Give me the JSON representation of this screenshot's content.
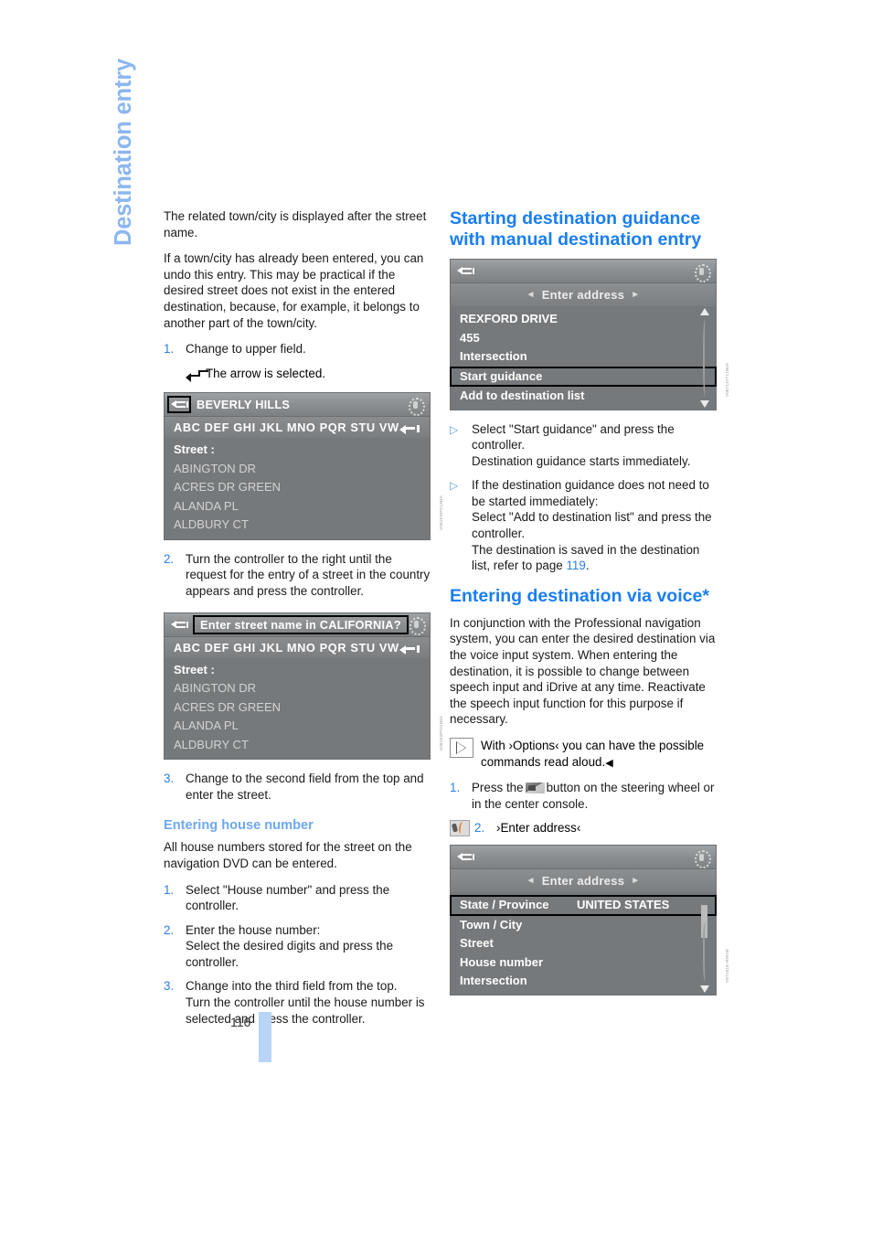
{
  "chapter": {
    "title": "Destination entry"
  },
  "page": {
    "number": "116"
  },
  "left_column": {
    "intro_1": "The related town/city is displayed after the street name.",
    "intro_2": "If a town/city has already been entered, you can undo this entry. This may be practical if the desired street does not exist in the entered destination, because, for example, it belongs to another part of the town/city.",
    "step1": {
      "num": "1.",
      "text": "Change to upper field.",
      "note": "The arrow is selected."
    },
    "step2": {
      "num": "2.",
      "text": "Turn the controller to the right until the request for the entry of a street in the country appears and press the controller."
    },
    "step3": {
      "num": "3.",
      "text": "Change to the second field from the top and enter the street."
    },
    "house_number": {
      "heading": "Entering house number",
      "intro": "All house numbers stored for the street on the navigation DVD can be entered.",
      "step1": {
        "num": "1.",
        "text": "Select \"House number\" and press the controller."
      },
      "step2": {
        "num": "2.",
        "text": "Enter the house number:",
        "sub": "Select the desired digits and press the controller."
      },
      "step3": {
        "num": "3.",
        "text": "Change into the third field from the top.",
        "sub": "Turn the controller until the house number is selected and press the controller."
      }
    }
  },
  "right_column": {
    "heading_guidance": "Starting destination guidance with manual destination entry",
    "bullet1": {
      "marker": "▷",
      "text": "Select \"Start guidance\" and press the controller.",
      "sub": "Destination guidance starts immediately."
    },
    "bullet2": {
      "marker": "▷",
      "text": "If the destination guidance does not need to be started immediately:",
      "sub1": "Select \"Add to destination list\" and press the controller.",
      "sub2_pre": "The destination is saved in the destination list, refer to page ",
      "sub2_page": "119",
      "sub2_post": "."
    },
    "heading_voice": "Entering destination via voice*",
    "voice_intro": "In conjunction with the Professional navigation system, you can enter the desired destination via the voice input system. When entering the destination, it is possible to change between speech input and iDrive at any time. Reactivate the speech input function for this purpose if necessary.",
    "options_hint": {
      "text": "With ›Options‹ you can have the possible commands read aloud.",
      "endmark": "◀"
    },
    "voice_step1": {
      "num": "1.",
      "text_pre": "Press the",
      "text_post": "button on the steering wheel or in the center console."
    },
    "voice_step2": {
      "num": "2.",
      "text": "›Enter address‹"
    }
  },
  "screenshots": {
    "beverly_hills": {
      "back_icon": "back-arrow-icon",
      "title": "BEVERLY HILLS",
      "knob_icon": "controller-knob-icon",
      "keys": "ABC DEF GHI JKL MNO PQR STU VW",
      "backspace_icon": "backspace-icon",
      "list_label": "Street :",
      "items": [
        "ABINGTON DR",
        "ACRES DR GREEN",
        "ALANDA PL",
        "ALDBURY CT"
      ],
      "code": "V081EWFD1N4A"
    },
    "enter_street_name": {
      "back_icon": "back-arrow-icon",
      "title": "Enter street name in CALIFORNIA?",
      "knob_icon": "controller-knob-icon",
      "keys": "ABC DEF GHI JKL MNO PQR STU VW",
      "backspace_icon": "backspace-icon",
      "list_label": "Street :",
      "items": [
        "ABINGTON DR",
        "ACRES DR GREEN",
        "ALANDA PL",
        "ALDBURY CT"
      ],
      "code": "V081EWFD2N4A"
    },
    "start_guidance": {
      "back_icon": "back-arrow-icon",
      "nav_title": "Enter address",
      "nav_prev_icon": "chevron-left-icon",
      "nav_next_icon": "chevron-right-icon",
      "knob_icon": "controller-knob-icon",
      "items": [
        {
          "label": "REXFORD DRIVE",
          "selected": false
        },
        {
          "label": "455",
          "selected": false
        },
        {
          "label": "Intersection",
          "selected": false
        },
        {
          "label": "Start guidance",
          "selected": true
        },
        {
          "label": "Add to destination list",
          "selected": false
        }
      ],
      "code": "V087147711NVA"
    },
    "enter_address_voice": {
      "back_icon": "back-arrow-icon",
      "nav_title": "Enter address",
      "nav_prev_icon": "chevron-left-icon",
      "nav_next_icon": "chevron-right-icon",
      "knob_icon": "controller-knob-icon",
      "items": [
        {
          "label": "State / Province",
          "value": "UNITED STATES",
          "selected": true
        },
        {
          "label": "Town / City",
          "value": "",
          "selected": false
        },
        {
          "label": "Street",
          "value": "",
          "selected": false
        },
        {
          "label": "House number",
          "value": "",
          "selected": false
        },
        {
          "label": "Intersection",
          "value": "",
          "selected": false
        }
      ],
      "code": "V87161E-RNVW"
    }
  },
  "colors": {
    "accent_blue": "#1a7ef0",
    "subheading_blue": "#6ea8f0",
    "chapter_blue": "#8cb6ef",
    "page_bar": "#b9d4f7",
    "screen_bg": "#76797b"
  }
}
